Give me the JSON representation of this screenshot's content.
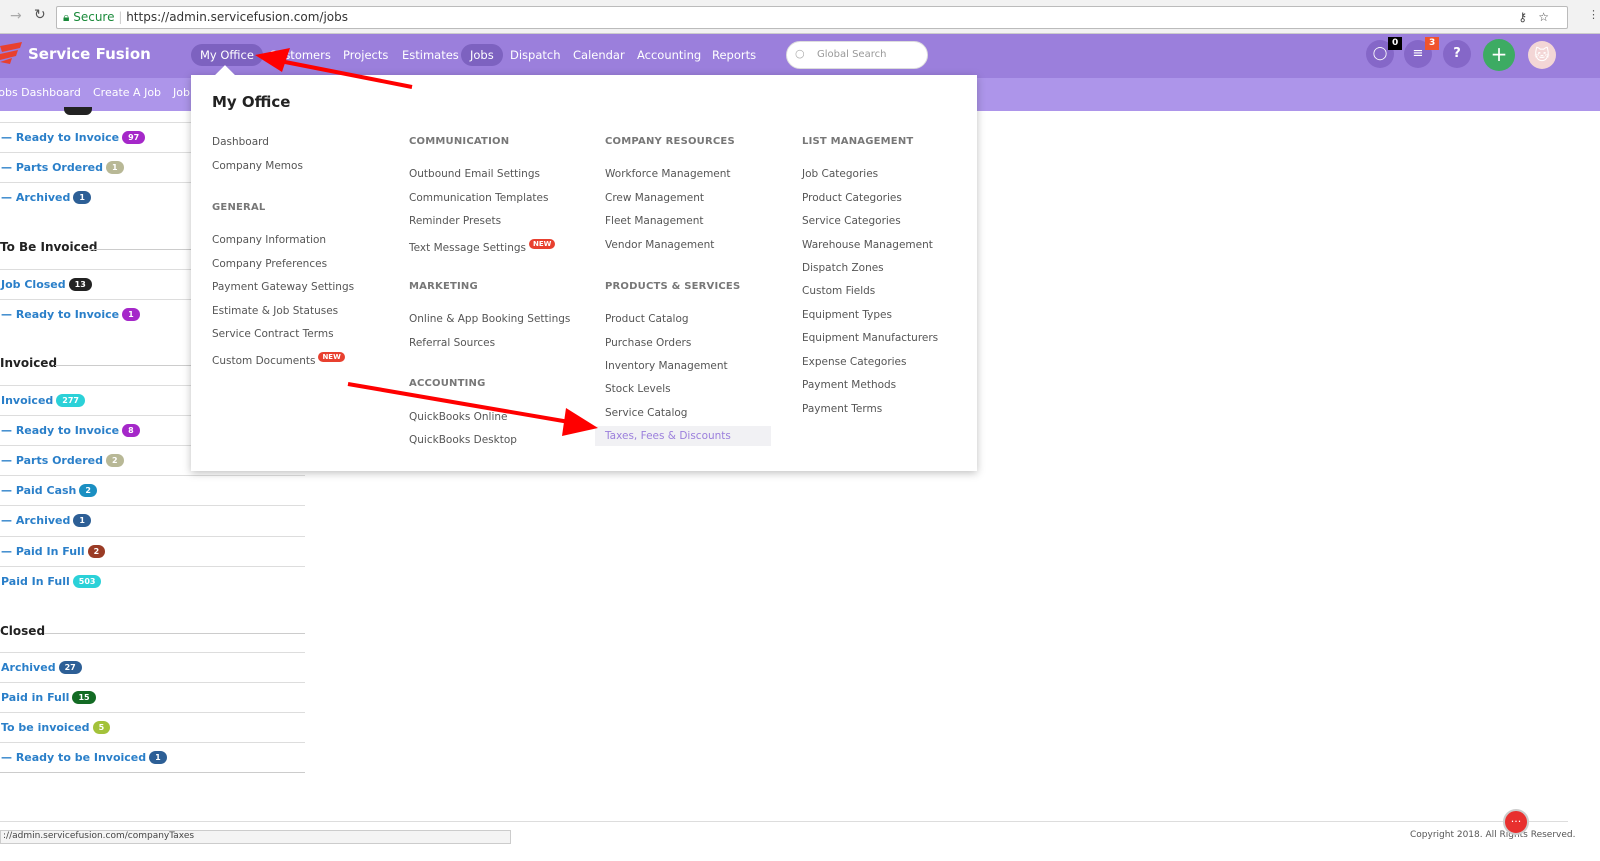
{
  "browser": {
    "secure": "Secure",
    "url": "https://admin.servicefusion.com/jobs",
    "status_url": "://admin.servicefusion.com/companyTaxes"
  },
  "brand": "Service Fusion",
  "nav": [
    "My Office",
    "Customers",
    "Projects",
    "Estimates",
    "Jobs",
    "Dispatch",
    "Calendar",
    "Accounting",
    "Reports"
  ],
  "search_placeholder": "Global Search",
  "header_badges": {
    "chat": "0",
    "notifications": "3",
    "help": "?"
  },
  "subnav": [
    "Jobs Dashboard",
    "Create A Job",
    "Job"
  ],
  "sidebar": {
    "sections": [
      {
        "title": "",
        "items": [
          {
            "label": "— Ready to Invoice",
            "count": "97",
            "color": "#a528c9"
          },
          {
            "label": "— Parts Ordered",
            "count": "1",
            "color": "#b8b896"
          },
          {
            "label": "— Archived",
            "count": "1",
            "color": "#2d5f96"
          }
        ]
      },
      {
        "title": "To Be Invoiced",
        "items": [
          {
            "label": "Job Closed",
            "count": "13",
            "color": "#222222"
          },
          {
            "label": "— Ready to Invoice",
            "count": "1",
            "color": "#a528c9"
          }
        ]
      },
      {
        "title": "Invoiced",
        "items": [
          {
            "label": "Invoiced",
            "count": "277",
            "color": "#2bd1d8"
          },
          {
            "label": "— Ready to Invoice",
            "count": "8",
            "color": "#a528c9"
          },
          {
            "label": "— Parts Ordered",
            "count": "2",
            "color": "#b8b896"
          },
          {
            "label": "— Paid Cash",
            "count": "2",
            "color": "#1a8fc2"
          },
          {
            "label": "— Archived",
            "count": "1",
            "color": "#2d5f96"
          },
          {
            "label": "— Paid In Full",
            "count": "2",
            "color": "#9a3b25"
          },
          {
            "label": "Paid In Full",
            "count": "503",
            "color": "#2bd1d8"
          }
        ]
      },
      {
        "title": "Closed",
        "items": [
          {
            "label": "Archived",
            "count": "27",
            "color": "#2d5f96"
          },
          {
            "label": "Paid in Full",
            "count": "15",
            "color": "#136b24"
          },
          {
            "label": "To be invoiced",
            "count": "5",
            "color": "#a3c23a"
          },
          {
            "label": "— Ready to be Invoiced",
            "count": "1",
            "color": "#2d5f96"
          }
        ]
      }
    ]
  },
  "menu": {
    "title": "My Office",
    "columns": [
      [
        {
          "items": [
            "Dashboard",
            "Company Memos"
          ]
        },
        {
          "heading": "GENERAL",
          "items": [
            "Company Information",
            "Company Preferences",
            "Payment Gateway Settings",
            "Estimate & Job Statuses",
            "Service Contract Terms",
            "Custom Documents"
          ]
        }
      ],
      [
        {
          "heading": "COMMUNICATION",
          "items": [
            "Outbound Email Settings",
            "Communication Templates",
            "Reminder Presets",
            "Text Message Settings"
          ]
        },
        {
          "heading": "MARKETING",
          "items": [
            "Online & App Booking Settings",
            "Referral Sources"
          ]
        },
        {
          "heading": "ACCOUNTING",
          "items": [
            "QuickBooks Online",
            "QuickBooks Desktop"
          ]
        }
      ],
      [
        {
          "heading": "COMPANY RESOURCES",
          "items": [
            "Workforce Management",
            "Crew Management",
            "Fleet Management",
            "Vendor Management"
          ]
        },
        {
          "heading": "PRODUCTS & SERVICES",
          "items": [
            "Product Catalog",
            "Purchase Orders",
            "Inventory Management",
            "Stock Levels",
            "Service Catalog",
            "Taxes, Fees & Discounts"
          ]
        }
      ],
      [
        {
          "heading": "LIST MANAGEMENT",
          "items": [
            "Job Categories",
            "Product Categories",
            "Service Categories",
            "Warehouse Management",
            "Dispatch Zones",
            "Custom Fields",
            "Equipment Types",
            "Equipment Manufacturers",
            "Expense Categories",
            "Payment Methods",
            "Payment Terms"
          ]
        }
      ]
    ],
    "new_badge": "NEW",
    "new_items": [
      "Text Message Settings",
      "Custom Documents"
    ],
    "highlighted": "Taxes, Fees & Discounts"
  },
  "footer": {
    "copyright": "Copyright 2018. All Rights Reserved."
  },
  "colors": {
    "nav": "#9b7fdc",
    "subnav": "#ad95ea",
    "link": "#2a7fc9",
    "highlight": "#9b7fdc",
    "annotation_arrow": "#ff0000"
  }
}
